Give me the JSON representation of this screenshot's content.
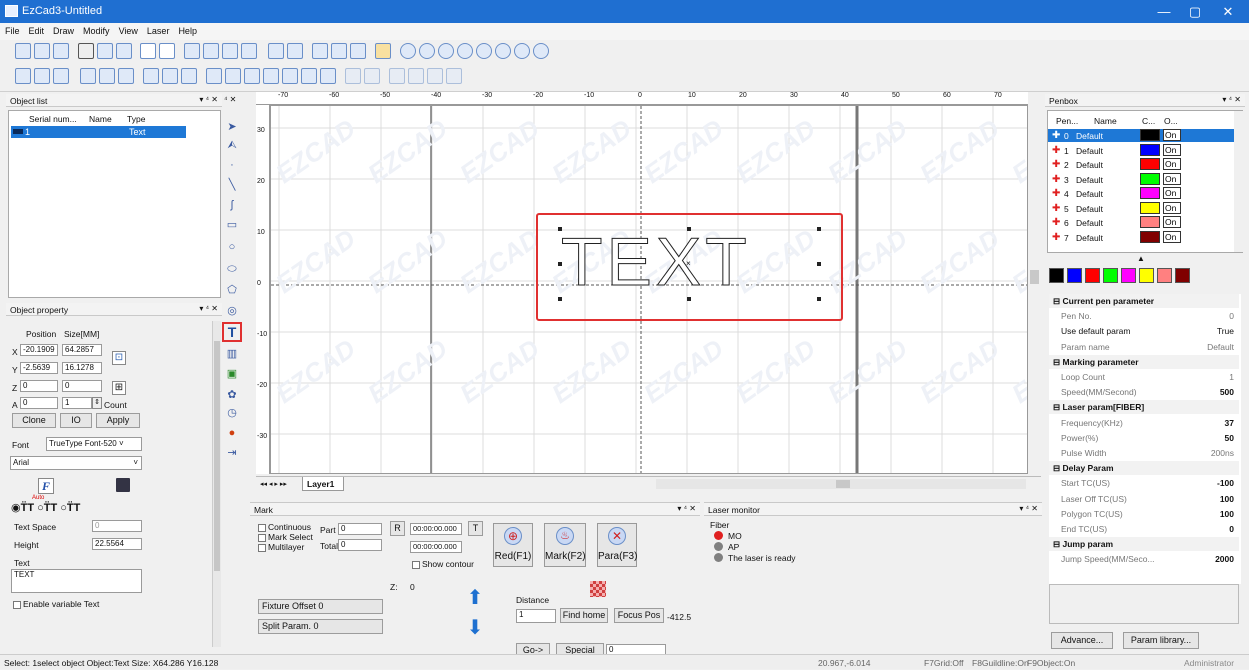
{
  "window": {
    "title": "EzCad3-Untitled",
    "min": "—",
    "max": "▢",
    "close": "✕"
  },
  "menu": [
    "File",
    "Edit",
    "Draw",
    "Modify",
    "View",
    "Laser",
    "Help"
  ],
  "object_list": {
    "title": "Object list",
    "columns": [
      "Serial num...",
      "Name",
      "Type"
    ],
    "rows": [
      {
        "serial": "1",
        "name": "",
        "type": "Text"
      }
    ]
  },
  "object_property": {
    "title": "Object property",
    "position_label": "Position",
    "size_label": "Size[MM]",
    "x_label": "X",
    "x_pos": "-20.1909",
    "x_size": "64.2857",
    "y_label": "Y",
    "y_pos": "-2.5639",
    "y_size": "16.1278",
    "z_label": "Z",
    "z_pos": "0",
    "z_size": "0",
    "a_label": "A",
    "a_pos": "0",
    "count": "1",
    "count_label": "Count",
    "clone": "Clone",
    "io": "IO",
    "apply": "Apply",
    "font_label": "Font",
    "font_type": "TrueType Font-520",
    "font_name": "Arial",
    "auto_label": "Auto",
    "text_space_label": "Text Space",
    "text_space": "0",
    "height_label": "Height",
    "height": "22.5564",
    "text_label": "Text",
    "text": "TEXT",
    "variable_text": "Enable variable Text"
  },
  "canvas": {
    "ruler_top": [
      "-70",
      "-60",
      "-50",
      "-40",
      "-30",
      "-20",
      "-10",
      "0",
      "10",
      "20",
      "30",
      "40",
      "50",
      "60",
      "70"
    ],
    "ruler_left": [
      "30",
      "20",
      "10",
      "0",
      "-10",
      "-20",
      "-30"
    ],
    "watermark": "EZCAD",
    "text_object": "TEXT",
    "layer_tab": "Layer1"
  },
  "mark": {
    "title": "Mark",
    "continuous": "Continuous",
    "mark_select": "Mark Select",
    "multilayer": "Multilayer",
    "part_label": "Part",
    "part": "0",
    "total_label": "Total",
    "total": "0",
    "r_btn": "R",
    "t_btn": "T",
    "time1": "00:00:00.000",
    "time2": "00:00:00.000",
    "show_contour": "Show contour",
    "red": "Red(F1)",
    "mark_btn": "Mark(F2)",
    "para": "Para(F3)",
    "z_label": "Z:",
    "z_value": "0",
    "fixture_offset": "Fixture Offset",
    "fixture_value": "0",
    "split_param": "Split Param.",
    "split_value": "0",
    "distance_label": "Distance",
    "distance": "1",
    "find_home": "Find home",
    "focus_pos": "Focus Pos",
    "focus_value": "-412.5",
    "go": "Go->",
    "special_pos": "Special pos",
    "special_value": "0"
  },
  "laser_monitor": {
    "title": "Laser monitor",
    "fiber": "Fiber",
    "items": [
      {
        "label": "MO",
        "color": "#e02020"
      },
      {
        "label": "AP",
        "color": "#808080"
      },
      {
        "label": "The laser is ready",
        "color": "#808080"
      }
    ]
  },
  "penbox": {
    "title": "Penbox",
    "columns": [
      "Pen...",
      "Name",
      "C...",
      "O..."
    ],
    "pens": [
      {
        "no": "0",
        "name": "Default",
        "color": "#000000",
        "on": "On"
      },
      {
        "no": "1",
        "name": "Default",
        "color": "#0000ff",
        "on": "On"
      },
      {
        "no": "2",
        "name": "Default",
        "color": "#ff0000",
        "on": "On"
      },
      {
        "no": "3",
        "name": "Default",
        "color": "#00ff00",
        "on": "On"
      },
      {
        "no": "4",
        "name": "Default",
        "color": "#ff00ff",
        "on": "On"
      },
      {
        "no": "5",
        "name": "Default",
        "color": "#ffff00",
        "on": "On"
      },
      {
        "no": "6",
        "name": "Default",
        "color": "#ff8080",
        "on": "On"
      },
      {
        "no": "7",
        "name": "Default",
        "color": "#800000",
        "on": "On"
      }
    ],
    "swatches": [
      "#000000",
      "#0000ff",
      "#ff0000",
      "#00ff00",
      "#ff00ff",
      "#ffff00",
      "#ff8080",
      "#800000"
    ],
    "params": [
      {
        "cat": "Current pen parameter"
      },
      {
        "k": "Pen No.",
        "v": "0"
      },
      {
        "k": "Use default param",
        "v": "True",
        "dark": true
      },
      {
        "k": "Param name",
        "v": "Default"
      },
      {
        "cat": "Marking parameter"
      },
      {
        "k": "Loop Count",
        "v": "1"
      },
      {
        "k": "Speed(MM/Second)",
        "v": "500",
        "bold": true
      },
      {
        "cat": "Laser param[FIBER]"
      },
      {
        "k": "Frequency(KHz)",
        "v": "37",
        "bold": true
      },
      {
        "k": "Power(%)",
        "v": "50",
        "bold": true
      },
      {
        "k": "Pulse Width",
        "v": "200ns"
      },
      {
        "cat": "Delay Param"
      },
      {
        "k": "Start TC(US)",
        "v": "-100",
        "bold": true
      },
      {
        "k": "Laser Off TC(US)",
        "v": "100",
        "bold": true
      },
      {
        "k": "Polygon TC(US)",
        "v": "100",
        "bold": true
      },
      {
        "k": "End TC(US)",
        "v": "0",
        "bold": true
      },
      {
        "cat": "Jump param"
      },
      {
        "k": "Jump Speed(MM/Seco...",
        "v": "2000",
        "bold": true
      }
    ],
    "advance": "Advance...",
    "param_library": "Param library..."
  },
  "status": {
    "left": "Select: 1select object Object:Text Size: X64.286 Y16.128",
    "coords": "20.967,-6.014",
    "grid": "F7Grid:Off",
    "guideline": "F8Guildline:On",
    "object": "F9Object:On",
    "user": "Administrator"
  }
}
